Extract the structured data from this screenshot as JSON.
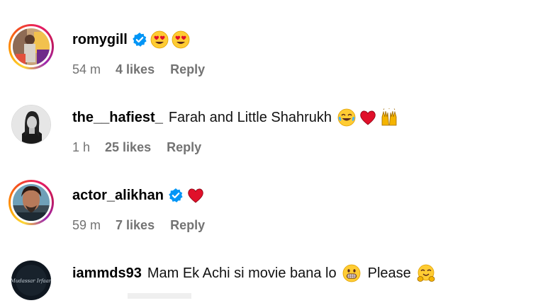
{
  "comments": [
    {
      "username": "romygill",
      "verified": true,
      "text": "",
      "emojis": [
        "heart-eyes",
        "heart-eyes"
      ],
      "time": "54 m",
      "likes": "4 likes",
      "reply": "Reply"
    },
    {
      "username": "the__hafiest_",
      "verified": false,
      "text": "Farah and Little Shahrukh",
      "emojis": [
        "tears-of-joy",
        "red-heart",
        "raising-hands"
      ],
      "time": "1 h",
      "likes": "25 likes",
      "reply": "Reply"
    },
    {
      "username": "actor_alikhan",
      "verified": true,
      "text": "",
      "emojis": [
        "red-heart"
      ],
      "time": "59 m",
      "likes": "7 likes",
      "reply": "Reply"
    },
    {
      "username": "iammds93",
      "verified": false,
      "text": "Mam Ek Achi si movie bana lo",
      "text2": "Please",
      "emojis": [
        "grinning-teeth",
        "hugging-face"
      ]
    }
  ],
  "avatar4_text": "Mudassar Irfaan",
  "colors": {
    "verified_blue": "#0095f6",
    "meta_gray": "#737373",
    "heart_red": "#e0102a"
  }
}
